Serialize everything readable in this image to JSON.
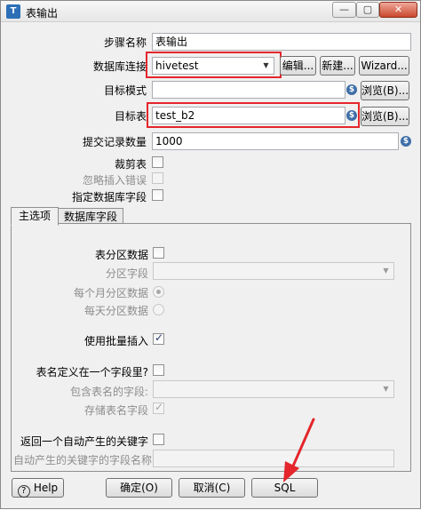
{
  "window": {
    "title": "表输出",
    "title_icon": "T"
  },
  "titlebar_buttons": {
    "minimize": "—",
    "maximize": "▢",
    "close": "✕"
  },
  "form": {
    "step_name_label": "步骤名称",
    "step_name_value": "表输出",
    "connection_label": "数据库连接",
    "connection_value": "hivetest",
    "edit_button": "编辑...",
    "new_button": "新建...",
    "wizard_button": "Wizard...",
    "target_schema_label": "目标模式",
    "target_schema_value": "",
    "browse_button": "浏览(B)...",
    "target_table_label": "目标表",
    "target_table_value": "test_b2",
    "commit_size_label": "提交记录数量",
    "commit_size_value": "1000",
    "truncate_label": "裁剪表",
    "ignore_errors_label": "忽略插入错误",
    "specify_fields_label": "指定数据库字段",
    "variable_icon_text": "$"
  },
  "tabs": [
    {
      "label": "主选项"
    },
    {
      "label": "数据库字段"
    }
  ],
  "main_tab": {
    "partition_label": "表分区数据",
    "partition_field_label": "分区字段",
    "partition_field_value": "",
    "monthly_label": "每个月分区数据",
    "daily_label": "每天分区数据",
    "batch_insert_label": "使用批量插入",
    "table_in_field_label": "表名定义在一个字段里?",
    "table_name_field_label": "包含表名的字段:",
    "table_name_field_value": "",
    "store_table_name_label": "存储表名字段",
    "return_keys_label": "返回一个自动产生的关键字",
    "key_field_name_label": "自动产生的关键字的字段名称",
    "key_field_name_value": ""
  },
  "bottom_buttons": {
    "help": "Help",
    "ok": "确定(O)",
    "cancel": "取消(C)",
    "sql": "SQL"
  },
  "checkmark": "✓",
  "colors": {
    "highlight_box": "#e4262c",
    "arrow": "#e4262c"
  }
}
